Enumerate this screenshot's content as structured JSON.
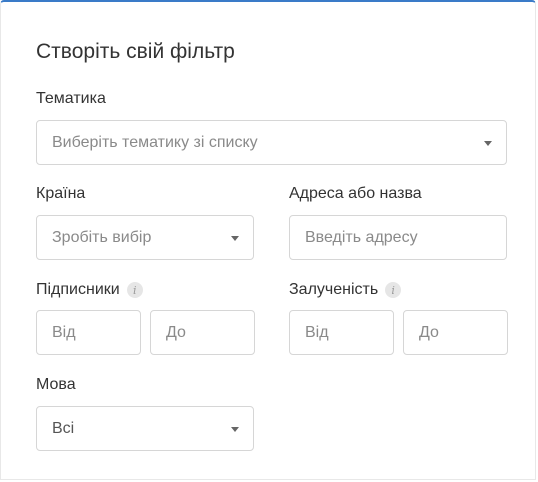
{
  "form": {
    "title": "Створіть свій фільтр",
    "topic": {
      "label": "Тематика",
      "placeholder": "Виберіть тематику зі списку"
    },
    "country": {
      "label": "Країна",
      "placeholder": "Зробіть вибір"
    },
    "address": {
      "label": "Адреса або назва",
      "placeholder": "Введіть адресу"
    },
    "subscribers": {
      "label": "Підписники",
      "info_icon": "info-icon",
      "from_placeholder": "Від",
      "to_placeholder": "До"
    },
    "engagement": {
      "label": "Залученість",
      "info_icon": "info-icon",
      "from_placeholder": "Від",
      "to_placeholder": "До"
    },
    "language": {
      "label": "Мова",
      "value": "Всі"
    }
  },
  "colors": {
    "accent_border": "#3a7bc8",
    "field_border": "#d6d6d6",
    "placeholder_text": "#8a8a8a"
  }
}
